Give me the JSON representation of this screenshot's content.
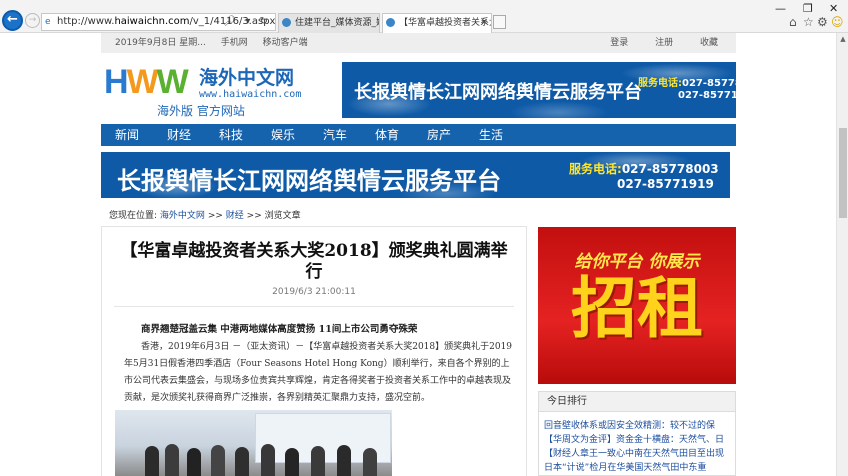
{
  "browser": {
    "url_prefix": "http://www.",
    "url_domain": "haiwaichn.com",
    "url_path": "/v_1/4116/3.aspx",
    "tabs": [
      {
        "label": "住建平台_媒体资源_媒介资源..."
      },
      {
        "label": "【华富卓越投资者关系大奖..."
      }
    ]
  },
  "topbar": {
    "date": "2019年9月8日 星期...",
    "mobile": "手机网",
    "client": "移动客户端",
    "login": "登录",
    "register": "注册",
    "favorite": "收藏"
  },
  "logo": {
    "hww": [
      "H",
      "W",
      "W"
    ],
    "cn_name": "海外中文网",
    "url": "www.haiwaichn.com",
    "sub": "海外版 官方网站"
  },
  "banner": {
    "title": "长报舆情长江网网络舆情云服务平台",
    "phone_label": "服务电话:",
    "phone1": "027-85778003",
    "phone2": "027-85771919"
  },
  "nav": [
    "新闻",
    "财经",
    "科技",
    "娱乐",
    "汽车",
    "体育",
    "房产",
    "生活"
  ],
  "breadcrumb": {
    "prefix": "您现在位置:",
    "site": "海外中文网",
    "sep1": ">>",
    "section": "财经",
    "sep2": ">>",
    "current": "浏览文章"
  },
  "article": {
    "title": "【华富卓越投资者关系大奖2018】颁奖典礼圆满举行",
    "date": "2019/6/3 21:00:11",
    "lead": "商界翘楚冠盖云集 中港两地媒体高度赞扬 11间上市公司勇夺殊荣",
    "body": "香港，2019年6月3日 －（亚太资讯）－【华富卓越投资者关系大奖2018】颁奖典礼于2019年5月31日假香港四季酒店（Four Seasons Hotel Hong Kong）顺利举行，来自各个界别的上市公司代表云集盛会，与现场多位贵宾共享辉煌，肯定各得奖者于投资者关系工作中的卓越表现及贡献，是次颁奖礼获得商界广泛推崇，各界别精英汇聚鼎力支持，盛况空前。"
  },
  "sidebar": {
    "ad_top": "给你平台 你展示",
    "ad_big": "招租",
    "box_title": "今日排行",
    "items": [
      "回音壁收体系或因安全效精测：较不过的保",
      "【华周文为金评】资金金十横盘：天然气、日",
      "【财经人章王一致心中南在天然气田目至出现",
      "日本“计说”检月在华美国天然气田中东重"
    ]
  },
  "colors": {
    "nav_blue": "#1562ad",
    "banner_blue": "#0e5aa7",
    "ad_red": "#d81818",
    "ad_yellow": "#ffd21c"
  }
}
